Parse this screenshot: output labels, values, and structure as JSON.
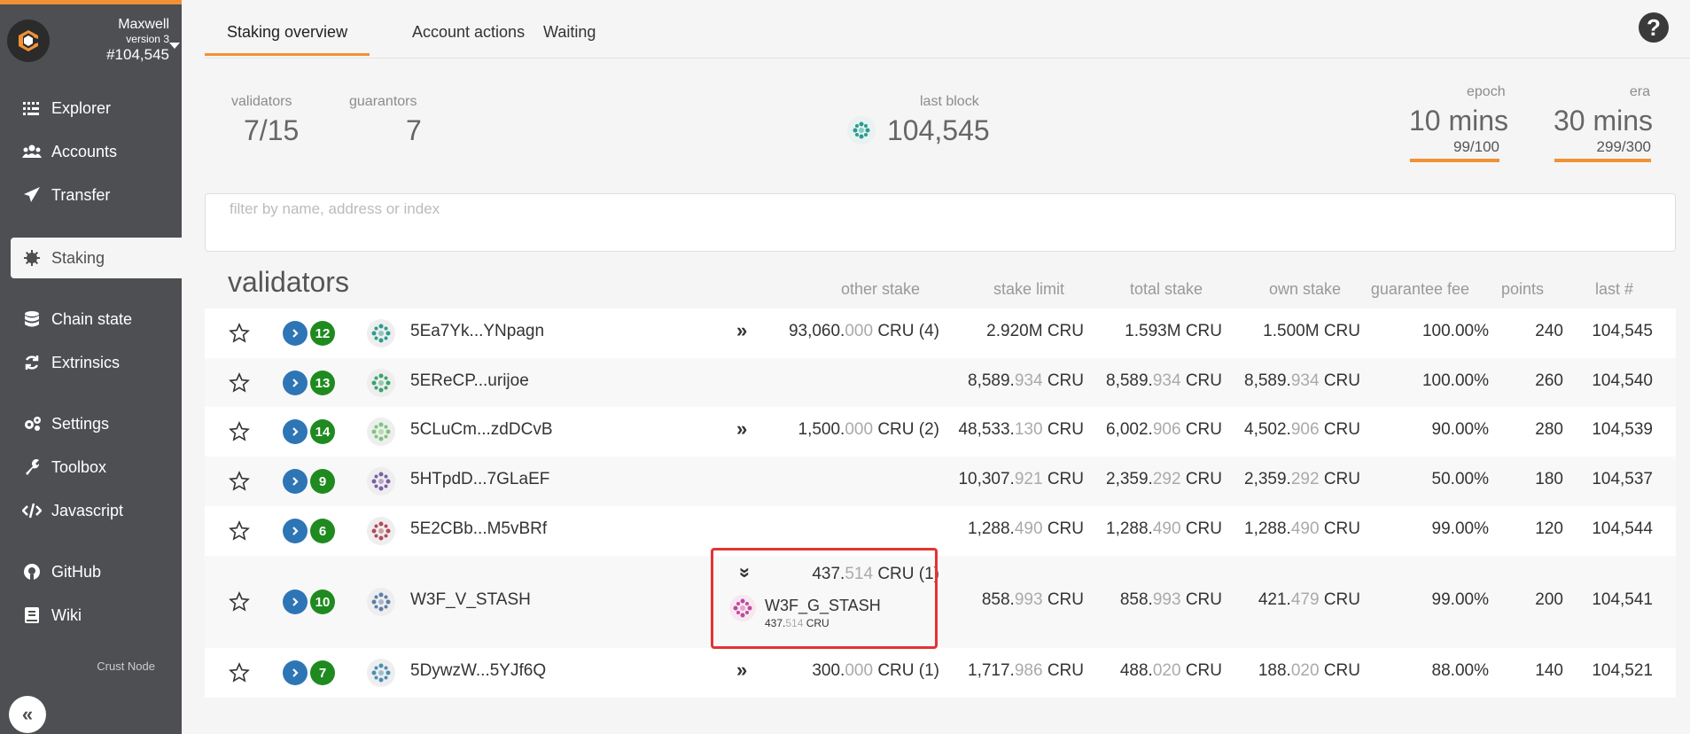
{
  "sidebar": {
    "chain_name": "Maxwell",
    "version": "version 3",
    "block": "#104,545",
    "items": [
      {
        "label": "Explorer",
        "icon": "grid-icon"
      },
      {
        "label": "Accounts",
        "icon": "users-icon"
      },
      {
        "label": "Transfer",
        "icon": "send-icon"
      },
      {
        "label": "Staking",
        "icon": "certificate-icon"
      },
      {
        "label": "Chain state",
        "icon": "database-icon"
      },
      {
        "label": "Extrinsics",
        "icon": "sync-icon"
      },
      {
        "label": "Settings",
        "icon": "cogs-icon"
      },
      {
        "label": "Toolbox",
        "icon": "wrench-icon"
      },
      {
        "label": "Javascript",
        "icon": "code-icon"
      },
      {
        "label": "GitHub",
        "icon": "github-icon"
      },
      {
        "label": "Wiki",
        "icon": "book-icon"
      }
    ],
    "footer": "Crust Node",
    "collapse": "«"
  },
  "tabs": [
    "Staking overview",
    "Account actions",
    "Waiting"
  ],
  "help": "?",
  "summary": {
    "validators_label": "validators",
    "validators_value": "7/15",
    "guarantors_label": "guarantors",
    "guarantors_value": "7",
    "last_block_label": "last block",
    "last_block_value": "104,545",
    "epoch_label": "epoch",
    "epoch_value": "10 mins",
    "epoch_progress": "99/100",
    "era_label": "era",
    "era_value": "30 mins",
    "era_progress": "299/300"
  },
  "filter": {
    "placeholder": "filter by name, address or index"
  },
  "table": {
    "title": "validators",
    "headers": {
      "other_stake": "other stake",
      "stake_limit": "stake limit",
      "total_stake": "total stake",
      "own_stake": "own stake",
      "guarantee_fee": "guarantee fee",
      "points": "points",
      "last": "last #"
    },
    "rows": [
      {
        "badge": "12",
        "name": "5Ea7Yk...YNpagn",
        "other_int": "93,060.",
        "other_dec": "000",
        "other_unit": " CRU (4)",
        "limit_int": "2.920M CRU",
        "limit_dec": "",
        "limit_unit": "",
        "total_int": "1.593M CRU",
        "total_dec": "",
        "total_unit": "",
        "own_int": "1.500M CRU",
        "own_dec": "",
        "own_unit": "",
        "fee": "100.00%",
        "points": "240",
        "last": "104,545"
      },
      {
        "badge": "13",
        "name": "5EReCP...urijoe",
        "other_int": "",
        "other_dec": "",
        "other_unit": "",
        "limit_int": "8,589.",
        "limit_dec": "934",
        "limit_unit": " CRU",
        "total_int": "8,589.",
        "total_dec": "934",
        "total_unit": " CRU",
        "own_int": "8,589.",
        "own_dec": "934",
        "own_unit": " CRU",
        "fee": "100.00%",
        "points": "260",
        "last": "104,540"
      },
      {
        "badge": "14",
        "name": "5CLuCm...zdDCvB",
        "other_int": "1,500.",
        "other_dec": "000",
        "other_unit": " CRU (2)",
        "limit_int": "48,533.",
        "limit_dec": "130",
        "limit_unit": " CRU",
        "total_int": "6,002.",
        "total_dec": "906",
        "total_unit": " CRU",
        "own_int": "4,502.",
        "own_dec": "906",
        "own_unit": " CRU",
        "fee": "90.00%",
        "points": "280",
        "last": "104,539"
      },
      {
        "badge": "9",
        "name": "5HTpdD...7GLaEF",
        "other_int": "",
        "other_dec": "",
        "other_unit": "",
        "limit_int": "10,307.",
        "limit_dec": "921",
        "limit_unit": " CRU",
        "total_int": "2,359.",
        "total_dec": "292",
        "total_unit": " CRU",
        "own_int": "2,359.",
        "own_dec": "292",
        "own_unit": " CRU",
        "fee": "50.00%",
        "points": "180",
        "last": "104,537"
      },
      {
        "badge": "6",
        "name": "5E2CBb...M5vBRf",
        "other_int": "",
        "other_dec": "",
        "other_unit": "",
        "limit_int": "1,288.",
        "limit_dec": "490",
        "limit_unit": " CRU",
        "total_int": "1,288.",
        "total_dec": "490",
        "total_unit": " CRU",
        "own_int": "1,288.",
        "own_dec": "490",
        "own_unit": " CRU",
        "fee": "99.00%",
        "points": "120",
        "last": "104,544"
      },
      {
        "badge": "10",
        "name": "W3F_V_STASH",
        "other_int": "437.",
        "other_dec": "514",
        "other_unit": " CRU (1)",
        "limit_int": "858.",
        "limit_dec": "993",
        "limit_unit": " CRU",
        "total_int": "858.",
        "total_dec": "993",
        "total_unit": " CRU",
        "own_int": "421.",
        "own_dec": "479",
        "own_unit": " CRU",
        "fee": "99.00%",
        "points": "200",
        "last": "104,541",
        "guarantor_name": "W3F_G_STASH",
        "guarantor_int": "437.",
        "guarantor_dec": "514",
        "guarantor_unit": " CRU"
      },
      {
        "badge": "7",
        "name": "5DywzW...5YJf6Q",
        "other_int": "300.",
        "other_dec": "000",
        "other_unit": " CRU (1)",
        "limit_int": "1,717.",
        "limit_dec": "986",
        "limit_unit": " CRU",
        "total_int": "488.",
        "total_dec": "020",
        "total_unit": " CRU",
        "own_int": "188.",
        "own_dec": "020",
        "own_unit": " CRU",
        "fee": "88.00%",
        "points": "140",
        "last": "104,521"
      }
    ]
  },
  "colors": {
    "accent": "#f19135",
    "sidebar": "#4d4f52",
    "badge": "#1f8a1f",
    "chevron": "#2e75b6",
    "highlight": "#e53232"
  }
}
